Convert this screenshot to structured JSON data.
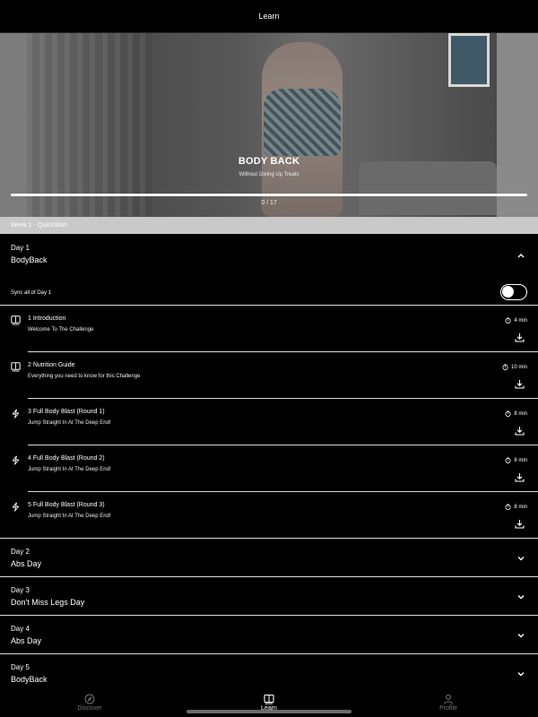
{
  "header": {
    "title": "Learn"
  },
  "hero": {
    "title": "BODY BACK",
    "subtitle": "Without Giving Up Treats",
    "progress_text": "0 / 17",
    "progress_fraction": 0
  },
  "week": {
    "label": "Week 1 - QuickStart"
  },
  "open_day": {
    "label": "Day 1",
    "name": "BodyBack",
    "sync_label": "Sync all of Day 1",
    "sync_on": false,
    "lessons": [
      {
        "title": "1 Introduction",
        "subtitle": "Welcome To The Challenge",
        "duration": "4 min",
        "icon": "book-icon"
      },
      {
        "title": "2 Nutrition Guide",
        "subtitle": "Everything you need to know for this Challenge",
        "duration": "10 min",
        "icon": "book-icon"
      },
      {
        "title": "3 Full Body Blast (Round 1)",
        "subtitle": "Jump Straight In At The Deep End!",
        "duration": "8 min",
        "icon": "bolt-icon"
      },
      {
        "title": "4 Full Body Blast (Round 2)",
        "subtitle": "Jump Straight In At The Deep End!",
        "duration": "8 min",
        "icon": "bolt-icon"
      },
      {
        "title": "5 Full Body Blast (Round 3)",
        "subtitle": "Jump Straight In At The Deep End!",
        "duration": "8 min",
        "icon": "bolt-icon"
      }
    ]
  },
  "closed_days": [
    {
      "label": "Day 2",
      "name": "Abs Day"
    },
    {
      "label": "Day 3",
      "name": "Don't Miss Legs Day"
    },
    {
      "label": "Day 4",
      "name": "Abs Day"
    },
    {
      "label": "Day 5",
      "name": "BodyBack"
    }
  ],
  "tabs": [
    {
      "label": "Discover",
      "icon": "compass-icon",
      "active": false
    },
    {
      "label": "Learn",
      "icon": "book-icon",
      "active": true
    },
    {
      "label": "Profile",
      "icon": "person-icon",
      "active": false
    }
  ]
}
